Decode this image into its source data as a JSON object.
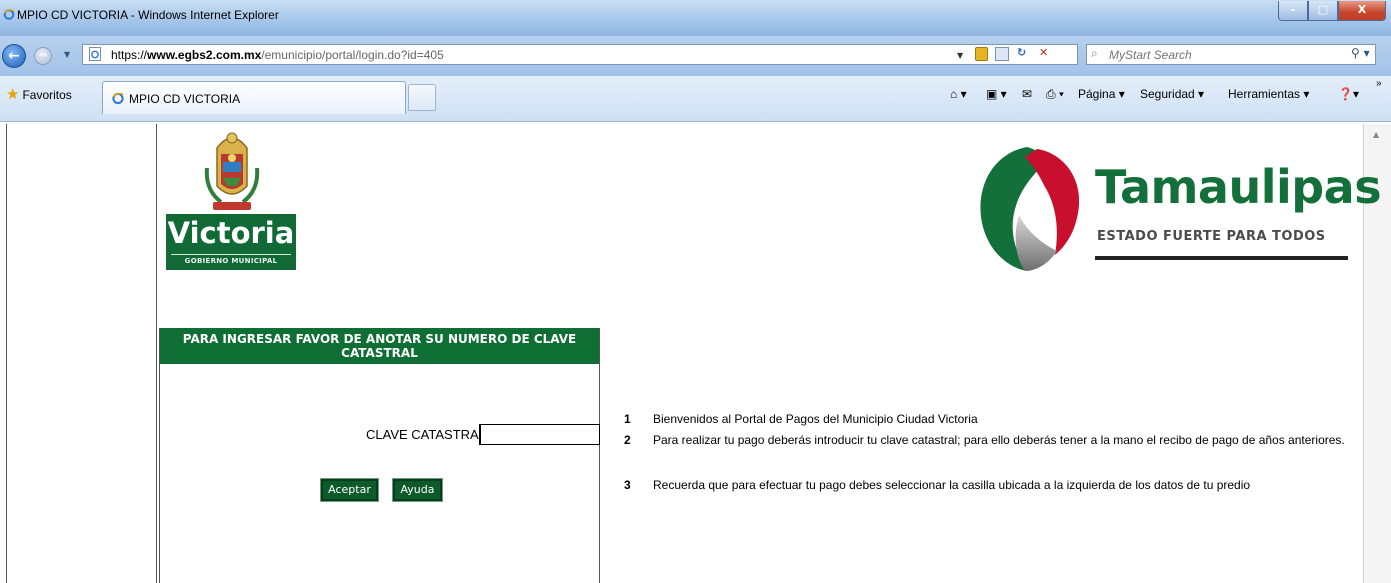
{
  "window": {
    "title": "MPIO CD VICTORIA - Windows Internet Explorer",
    "controls": {
      "minimize": "–",
      "maximize": "□",
      "close": "X"
    }
  },
  "address_bar": {
    "url_proto": "https://",
    "url_host": "www.egbs2.com.mx",
    "url_path": "/emunicipio/portal/login.do?id=405",
    "refresh_glyph": "↻",
    "stop_glyph": "✕"
  },
  "search": {
    "placeholder": "MyStart Search"
  },
  "tab_bar": {
    "favorites_label": "Favoritos",
    "tab_label": "MPIO CD VICTORIA",
    "commands": {
      "page": "Página ▾",
      "security": "Seguridad ▾",
      "tools": "Herramientas ▾"
    }
  },
  "logos": {
    "victoria_name": "Victoria",
    "victoria_sub": "GOBIERNO MUNICIPAL",
    "tamaulipas_name": "Tamaulipas",
    "tamaulipas_slogan": "ESTADO FUERTE PARA TODOS"
  },
  "login": {
    "header": "PARA INGRESAR FAVOR DE ANOTAR SU NUMERO DE CLAVE CATASTRAL",
    "field_label": "CLAVE CATASTRAL",
    "field_value": "",
    "accept_button": "Aceptar",
    "help_button": "Ayuda"
  },
  "instructions": [
    {
      "num": "1",
      "text": "Bienvenidos al Portal de Pagos del Municipio Ciudad Victoria"
    },
    {
      "num": "2",
      "text": "Para realizar tu pago deberás introducir tu clave catastral; para ello deberás tener a la mano el recibo de pago de años anteriores."
    },
    {
      "num": "3",
      "text": "Recuerda que para efectuar tu pago debes seleccionar la casilla ubicada a la izquierda de los datos de tu predio"
    }
  ],
  "colors": {
    "brand_green": "#0e6e34",
    "tamaulipas_green": "#14703a",
    "tamaulipas_red": "#c8102e",
    "ie_frame": "#a6c7ea"
  }
}
